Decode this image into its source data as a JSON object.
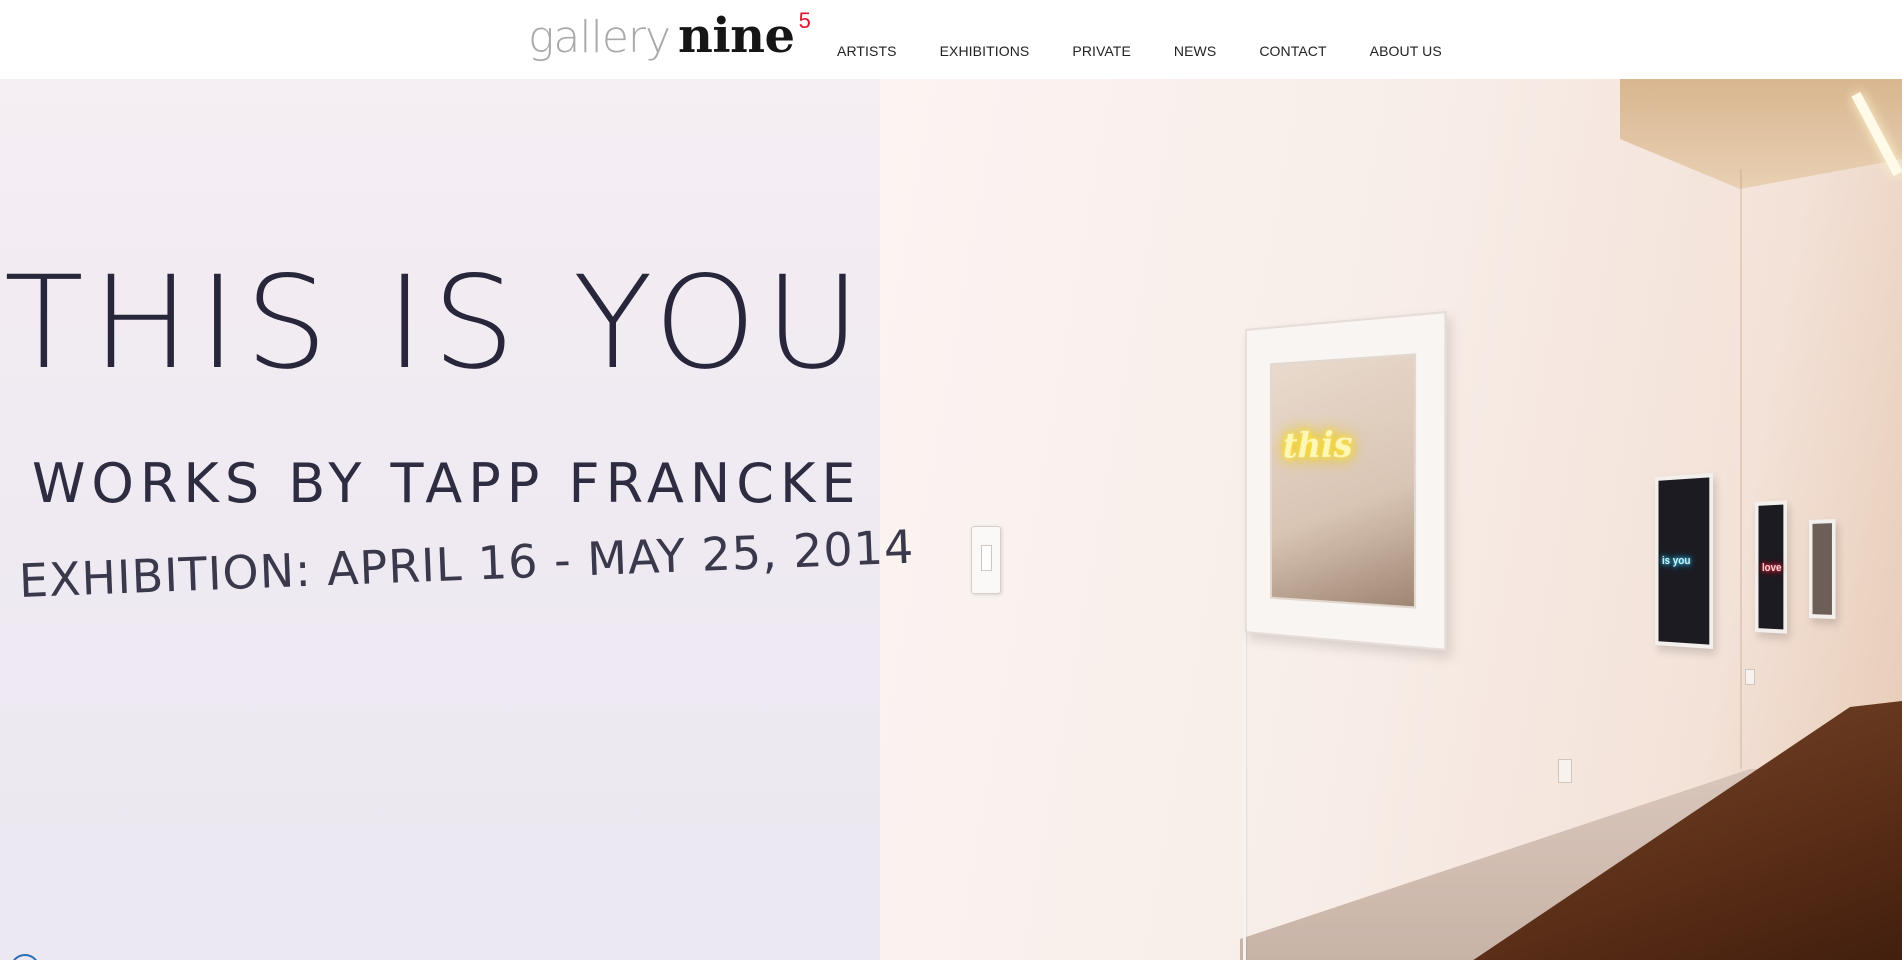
{
  "header": {
    "logo": {
      "light_text": "gallery",
      "bold_text": "nine",
      "superscript": "5"
    },
    "nav": [
      {
        "label": "ARTISTS"
      },
      {
        "label": "EXHIBITIONS"
      },
      {
        "label": "PRIVATE"
      },
      {
        "label": "NEWS"
      },
      {
        "label": "CONTACT"
      },
      {
        "label": "ABOUT US"
      }
    ]
  },
  "hero": {
    "wall_title": "THIS IS YOU",
    "wall_subtitle": "WORKS BY TAPP FRANCKE",
    "wall_dates": "EXHIBITION: APRIL 16 - MAY 25, 2014",
    "neon_main": "this",
    "neon_second": "is you",
    "neon_third": "love"
  },
  "colors": {
    "logo_accent": "#e1142c",
    "logo_grey": "#a9a9a9",
    "logo_dark": "#161616",
    "nav_text": "#222222",
    "wall_text": "#2b2a3d"
  },
  "icons": {
    "corner_badge": "circle-icon"
  }
}
